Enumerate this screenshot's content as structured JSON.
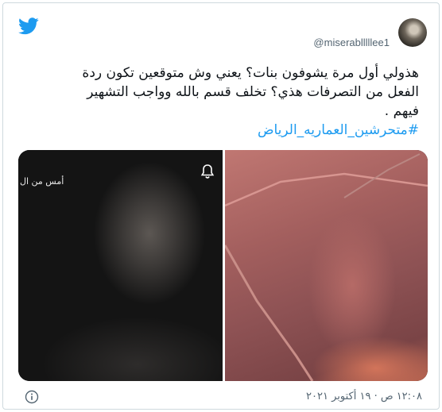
{
  "tweet": {
    "username": "@miserablllllee1",
    "text_lines": [
      "هذولي أول مرة يشوفون بنات؟ يعني وش متوقعين تكون ردة",
      "الفعل من التصرفات هذي؟ تخلف قسم بالله وواجب التشهير",
      "فيهم ."
    ],
    "hashtag": "#متحرشين_العماريه_الرياض",
    "timestamp": "١٢:٠٨ ص · ١٩ أكتوبر ٢٠٢١"
  },
  "media": {
    "left_overlay_text": "أمس من ال"
  },
  "colors": {
    "accent": "#1d9bf0",
    "text_secondary": "#536471",
    "border": "#cfd9de"
  },
  "icons": [
    "twitter-bird-icon",
    "bell-icon",
    "info-icon"
  ]
}
